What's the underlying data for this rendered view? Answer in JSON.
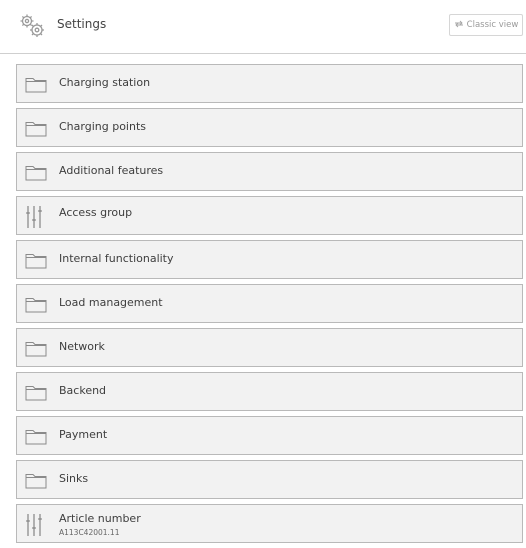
{
  "header": {
    "title": "Settings",
    "classic_view_label": "Classic view"
  },
  "items": [
    {
      "icon": "folder-icon",
      "label": "Charging station"
    },
    {
      "icon": "folder-icon",
      "label": "Charging points"
    },
    {
      "icon": "folder-icon",
      "label": "Additional features"
    },
    {
      "icon": "sliders-icon",
      "label": "Access group"
    },
    {
      "icon": "folder-icon",
      "label": "Internal functionality"
    },
    {
      "icon": "folder-icon",
      "label": "Load management"
    },
    {
      "icon": "folder-icon",
      "label": "Network"
    },
    {
      "icon": "folder-icon",
      "label": "Backend"
    },
    {
      "icon": "folder-icon",
      "label": "Payment"
    },
    {
      "icon": "folder-icon",
      "label": "Sinks"
    },
    {
      "icon": "sliders-icon",
      "label": "Article number",
      "value": "A113C42001.11"
    }
  ],
  "colors": {
    "row_background": "#f2f2f2",
    "row_border": "#b9b9b9",
    "header_border": "#cfcfcf"
  }
}
